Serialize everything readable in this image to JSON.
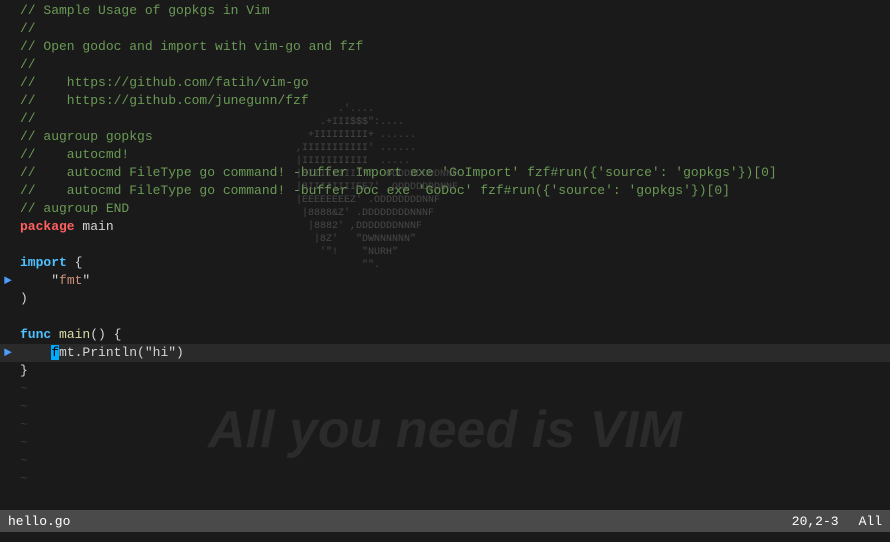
{
  "editor": {
    "lines": [
      {
        "id": 1,
        "type": "comment",
        "indicator": "",
        "content": "// Sample Usage of gopkgs in Vim"
      },
      {
        "id": 2,
        "type": "comment",
        "indicator": "",
        "content": "//"
      },
      {
        "id": 3,
        "type": "comment",
        "indicator": "",
        "content": "// Open godoc and import with vim-go and fzf"
      },
      {
        "id": 4,
        "type": "comment",
        "indicator": "",
        "content": "//"
      },
      {
        "id": 5,
        "type": "comment",
        "indicator": "",
        "content": "//    https://github.com/fatih/vim-go"
      },
      {
        "id": 6,
        "type": "comment",
        "indicator": "",
        "content": "//    https://github.com/junegunn/fzf"
      },
      {
        "id": 7,
        "type": "comment",
        "indicator": "",
        "content": "//"
      },
      {
        "id": 8,
        "type": "comment",
        "indicator": "",
        "content": "// augroup gopkgs"
      },
      {
        "id": 9,
        "type": "comment",
        "indicator": "",
        "content": "//    autocmd!"
      },
      {
        "id": 10,
        "type": "comment",
        "indicator": "",
        "content": "//    autocmd FileType go command! -buffer Import exe 'GoImport' fzf#run({'source': 'gopkgs'})[0]"
      },
      {
        "id": 11,
        "type": "comment",
        "indicator": "",
        "content": "//    autocmd FileType go command! -buffer Doc exe 'GoDoc' fzf#run({'source': 'gopkgs'})[0]"
      },
      {
        "id": 12,
        "type": "comment",
        "indicator": "",
        "content": "// augroup END"
      },
      {
        "id": 13,
        "type": "package",
        "indicator": "",
        "content_parts": [
          {
            "text": "package",
            "cls": "keyword-package"
          },
          {
            "text": " main",
            "cls": "normal"
          }
        ]
      },
      {
        "id": 14,
        "type": "blank",
        "indicator": "",
        "content": ""
      },
      {
        "id": 15,
        "type": "import",
        "indicator": "",
        "content_parts": [
          {
            "text": "import",
            "cls": "keyword-import"
          },
          {
            "text": " {",
            "cls": "normal"
          }
        ]
      },
      {
        "id": 16,
        "type": "arrow",
        "indicator": "►",
        "content_parts": [
          {
            "text": "    \"",
            "cls": "normal"
          },
          {
            "text": "fmt",
            "cls": "string"
          },
          {
            "text": "\"",
            "cls": "normal"
          }
        ]
      },
      {
        "id": 17,
        "type": "normal",
        "indicator": "",
        "content_parts": [
          {
            "text": ")",
            "cls": "normal"
          }
        ]
      },
      {
        "id": 18,
        "type": "blank",
        "indicator": "",
        "content": ""
      },
      {
        "id": 19,
        "type": "func",
        "indicator": "",
        "content_parts": [
          {
            "text": "func",
            "cls": "keyword-func"
          },
          {
            "text": " ",
            "cls": "normal"
          },
          {
            "text": "main",
            "cls": "fn-call"
          },
          {
            "text": "() {",
            "cls": "normal"
          }
        ]
      },
      {
        "id": 20,
        "type": "cursor",
        "indicator": "►",
        "content_parts": [
          {
            "text": "    ",
            "cls": "normal"
          },
          {
            "text": "f",
            "cls": "cursor-char"
          },
          {
            "text": "mt.Println(\"hi\")",
            "cls": "normal"
          }
        ]
      },
      {
        "id": 21,
        "type": "normal",
        "indicator": "",
        "content_parts": [
          {
            "text": "}",
            "cls": "normal"
          }
        ]
      },
      {
        "id": 22,
        "type": "tilde",
        "content": "~"
      },
      {
        "id": 23,
        "type": "tilde",
        "content": "~"
      },
      {
        "id": 24,
        "type": "tilde",
        "content": "~"
      },
      {
        "id": 25,
        "type": "tilde",
        "content": "~"
      },
      {
        "id": 26,
        "type": "tilde",
        "content": "~"
      },
      {
        "id": 27,
        "type": "tilde",
        "content": "~"
      }
    ]
  },
  "statusbar": {
    "filename": "hello.go",
    "position": "20,2-3",
    "scroll": "All"
  },
  "watermark": {
    "text": "All you need is VIM"
  }
}
